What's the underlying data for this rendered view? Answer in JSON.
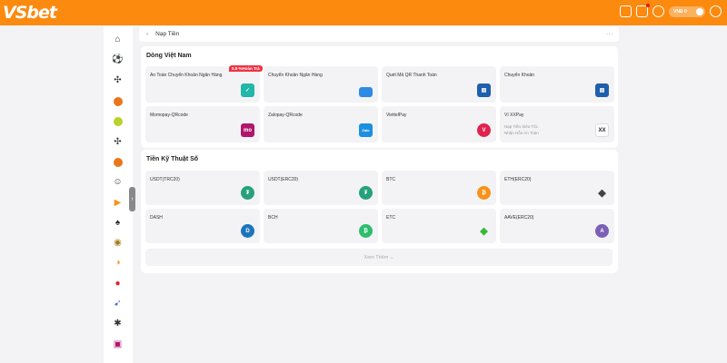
{
  "header": {
    "logo": "VSbet",
    "balance": "VNĐ 0"
  },
  "sidebar": {
    "icons": [
      "home-icon",
      "football-icon",
      "soccer-icon",
      "basketball-icon",
      "tennis-icon",
      "volleyball-icon",
      "ball-icon",
      "lottery-icon",
      "play-icon",
      "spade-icon",
      "casino-icon",
      "slot-icon",
      "fish-icon",
      "fire-icon",
      "star-icon",
      "crab-icon"
    ]
  },
  "topbar": {
    "back": "‹",
    "title": "Nạp Tiền",
    "more": "···"
  },
  "section1": {
    "title": "Dòng Việt Nam",
    "cards": [
      {
        "name": "An Toàn Chuyển Khoản Ngân Hàng",
        "badge": "0.8 %Hoàn Trả",
        "icon": "shield-icon",
        "color": "#22b7a8"
      },
      {
        "name": "Chuyển Khoản Ngân Hàng",
        "icon": "bank-card-icon",
        "color": "#2d8ce6"
      },
      {
        "name": "Quét Mã QR Thanh Toán",
        "icon": "qr-bank-icon",
        "color": "#1e5fae"
      },
      {
        "name": "Chuyển Khoản",
        "icon": "atm-icon",
        "color": "#1e5fae"
      },
      {
        "name": "Momopay-QRcode",
        "icon": "momo-icon",
        "color": "#b0166b",
        "glyph": "mo"
      },
      {
        "name": "Zalopay-QRcode",
        "icon": "zalopay-icon",
        "color": "#1d8fe0",
        "glyph": "Zalo"
      },
      {
        "name": "ViettelPay",
        "icon": "viettelpay-icon",
        "color": "#e0234e",
        "glyph": "V"
      },
      {
        "name": "Ví XXPay",
        "sub1": "Nạp Tiền Siêu Tốc",
        "sub2": "Nhận Hỗn An Toàn",
        "icon": "xxpay-icon",
        "color": "#222222",
        "glyph": "XX"
      }
    ]
  },
  "section2": {
    "title": "Tiền Kỹ Thuật Số",
    "cards": [
      {
        "name": "USDT(TRC20)",
        "icon": "usdt-trc20-icon",
        "color": "#26a17b",
        "glyph": "₮"
      },
      {
        "name": "USDT(ERC20)",
        "icon": "usdt-erc20-icon",
        "color": "#26a17b",
        "glyph": "₮"
      },
      {
        "name": "BTC",
        "icon": "bitcoin-icon",
        "color": "#f7931a",
        "glyph": "₿"
      },
      {
        "name": "ETH(ERC20)",
        "icon": "ethereum-icon",
        "color": "#444444",
        "glyph": "◆"
      },
      {
        "name": "DASH",
        "icon": "dash-icon",
        "color": "#1c75bc",
        "glyph": "D"
      },
      {
        "name": "BCH",
        "icon": "bitcoin-cash-icon",
        "color": "#2ebd6e",
        "glyph": "₿"
      },
      {
        "name": "ETC",
        "icon": "ethereum-classic-icon",
        "color": "#3ab83a",
        "glyph": "◆"
      },
      {
        "name": "AAVE(ERC20)",
        "icon": "aave-icon",
        "color": "#7b5fb5",
        "glyph": "A"
      }
    ],
    "more_label": "Xem Thêm ⌄"
  }
}
